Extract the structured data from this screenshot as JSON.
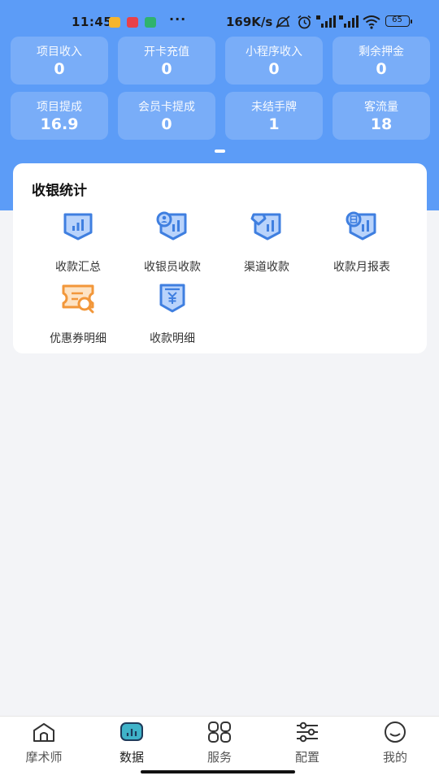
{
  "status_bar": {
    "time": "11:45",
    "dots": "···",
    "speed": "169K/s",
    "battery": "65"
  },
  "stats": [
    {
      "label": "项目收入",
      "value": "0"
    },
    {
      "label": "开卡充值",
      "value": "0"
    },
    {
      "label": "小程序收入",
      "value": "0"
    },
    {
      "label": "剩余押金",
      "value": "0"
    },
    {
      "label": "项目提成",
      "value": "16.9"
    },
    {
      "label": "会员卡提成",
      "value": "0"
    },
    {
      "label": "未结手牌",
      "value": "1"
    },
    {
      "label": "客流量",
      "value": "18"
    }
  ],
  "cashier": {
    "title": "收银统计",
    "items": [
      {
        "label": "收款汇总",
        "icon": "bar-chart-icon"
      },
      {
        "label": "收银员收款",
        "icon": "cashier-chart-icon"
      },
      {
        "label": "渠道收款",
        "icon": "channel-chart-icon"
      },
      {
        "label": "收款月报表",
        "icon": "monthly-report-icon"
      },
      {
        "label": "优惠券明细",
        "icon": "coupon-icon"
      },
      {
        "label": "收款明细",
        "icon": "yen-receipt-icon"
      }
    ]
  },
  "tabs": [
    {
      "label": "摩术师",
      "icon": "home-icon"
    },
    {
      "label": "数据",
      "icon": "data-icon",
      "active": true
    },
    {
      "label": "服务",
      "icon": "grid-icon"
    },
    {
      "label": "配置",
      "icon": "sliders-icon"
    },
    {
      "label": "我的",
      "icon": "smile-icon"
    }
  ],
  "colors": {
    "header_blue": "#5c9cf7",
    "icon_blue": "#3f7fe0",
    "icon_light_blue": "#b9d3fb",
    "coupon_orange": "#f2973a",
    "tab_active": "#3a8ad9"
  }
}
